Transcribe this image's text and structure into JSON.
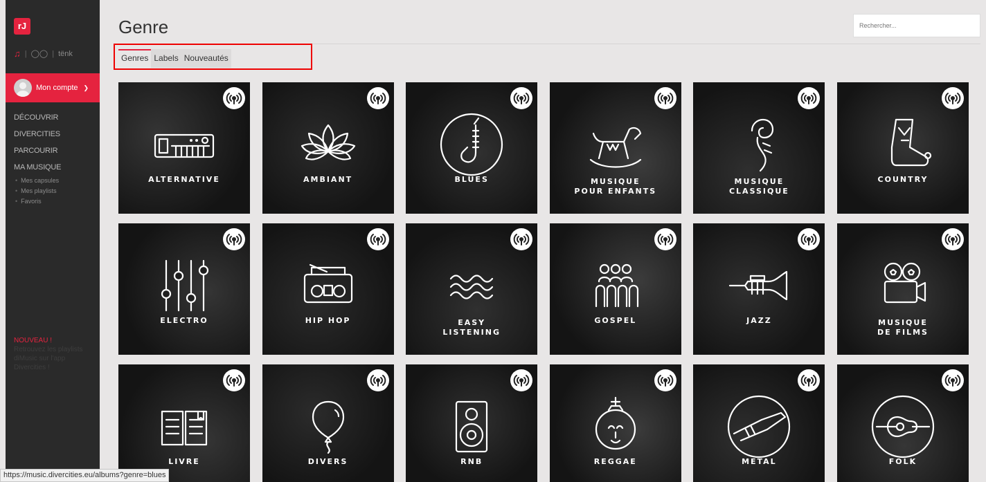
{
  "app": {
    "logo": "rJ",
    "title": "Genre"
  },
  "sidebar": {
    "modes": [
      "tënk"
    ],
    "account_label": "Mon compte",
    "nav": [
      {
        "label": "DÉCOUVRIR"
      },
      {
        "label": "DIVERCITIES"
      },
      {
        "label": "PARCOURIR"
      },
      {
        "label": "MA MUSIQUE"
      }
    ],
    "sub": [
      {
        "label": "Mes capsules"
      },
      {
        "label": "Mes playlists"
      },
      {
        "label": "Favoris"
      }
    ],
    "promo_new": "NOUVEAU !",
    "promo_text": "Retrouvez les playlists diMusic sur l'app Divercities !"
  },
  "search": {
    "placeholder": "Rechercher..."
  },
  "tabs": [
    {
      "label": "Genres"
    },
    {
      "label": "Labels"
    },
    {
      "label": "Nouveautés"
    }
  ],
  "genres": [
    {
      "lines": [
        "ALTERNATIVE"
      ],
      "icon": "synthesizer-icon"
    },
    {
      "lines": [
        "AMBIANT"
      ],
      "icon": "lotus-icon"
    },
    {
      "lines": [
        "BLUES"
      ],
      "icon": "saxophone-icon"
    },
    {
      "lines": [
        "MUSIQUE",
        "POUR ENFANTS"
      ],
      "icon": "rocking-horse-icon"
    },
    {
      "lines": [
        "MUSIQUE",
        "CLASSIQUE"
      ],
      "icon": "violin-scroll-icon"
    },
    {
      "lines": [
        "COUNTRY"
      ],
      "icon": "cowboy-boot-icon"
    },
    {
      "lines": [
        "ELECTRO"
      ],
      "icon": "equalizer-icon"
    },
    {
      "lines": [
        "HIP HOP"
      ],
      "icon": "boombox-icon"
    },
    {
      "lines": [
        "EASY",
        "LISTENING"
      ],
      "icon": "waves-icon"
    },
    {
      "lines": [
        "GOSPEL"
      ],
      "icon": "choir-icon"
    },
    {
      "lines": [
        "JAZZ"
      ],
      "icon": "trumpet-icon"
    },
    {
      "lines": [
        "MUSIQUE",
        "DE FILMS"
      ],
      "icon": "film-camera-icon"
    },
    {
      "lines": [
        "LIVRE"
      ],
      "icon": "book-icon"
    },
    {
      "lines": [
        "DIVERS"
      ],
      "icon": "balloon-icon"
    },
    {
      "lines": [
        "RNB"
      ],
      "icon": "speaker-icon"
    },
    {
      "lines": [
        "REGGAE"
      ],
      "icon": "lion-icon"
    },
    {
      "lines": [
        "METAL"
      ],
      "icon": "electric-guitar-icon"
    },
    {
      "lines": [
        "FOLK"
      ],
      "icon": "acoustic-guitar-icon"
    }
  ],
  "status_url": "https://music.divercities.eu/albums?genre=blues",
  "colors": {
    "accent": "#e5233f",
    "sidebar": "#2a2a2a",
    "background": "#e8e6e6"
  }
}
